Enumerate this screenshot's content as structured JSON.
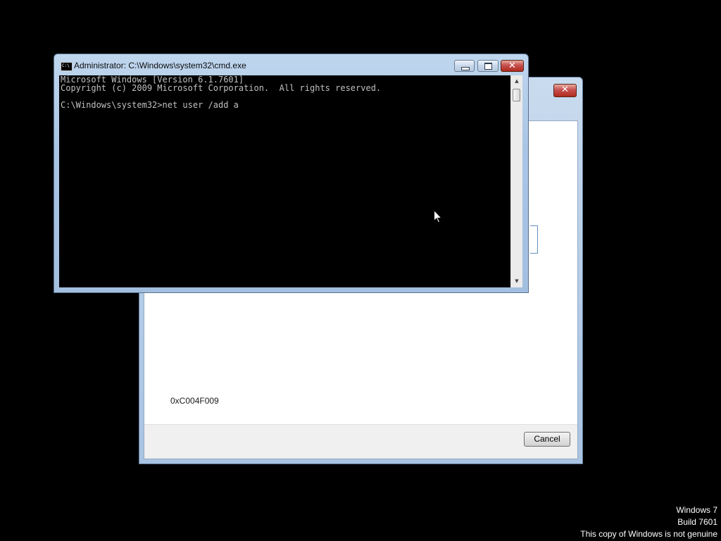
{
  "dialog": {
    "close_glyph": "✕",
    "error_code": "0xC004F009",
    "cancel_label": "Cancel"
  },
  "cmd": {
    "title": "Administrator: C:\\Windows\\system32\\cmd.exe",
    "icon_text": "C:\\",
    "close_glyph": "✕",
    "console_lines": "Microsoft Windows [Version 6.1.7601]\nCopyright (c) 2009 Microsoft Corporation.  All rights reserved.\n\nC:\\Windows\\system32>net user /add a"
  },
  "watermark": {
    "line1": "Windows 7",
    "line2": "Build 7601",
    "line3": "This copy of Windows is not genuine"
  },
  "colors": {
    "desktop": "#000000",
    "console_bg": "#000000",
    "console_text": "#c0c0c0",
    "close_red": "#c75050"
  }
}
